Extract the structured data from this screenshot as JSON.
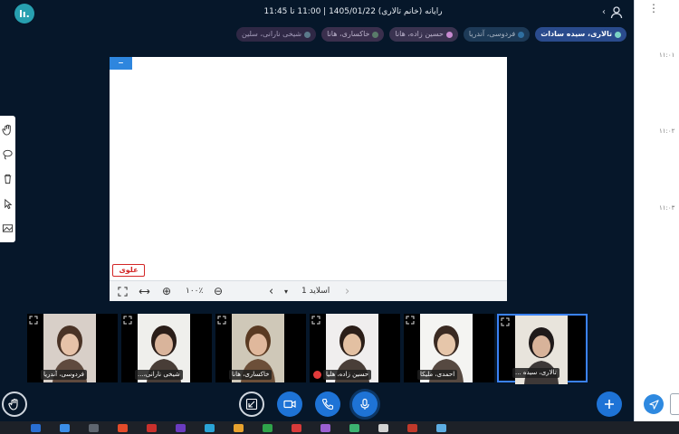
{
  "app": {
    "logo_text": "lı.",
    "meeting_title": "رایانه (خانم تالاری) 1405/01/22 | 11:00 تا 11:45",
    "chevron": "‹"
  },
  "participants": {
    "chips": [
      {
        "label": "تالاری، سیده سادات",
        "dot_color": "#7ad3c5",
        "style": "presenter"
      },
      {
        "label": "فردوسی، آندریا",
        "dot_color": "#2f6fa0",
        "style": "c2"
      },
      {
        "label": "حسین زاده، هانا",
        "dot_color": "#c78ad0",
        "style": "c3"
      },
      {
        "label": "خاکساری، هانا",
        "dot_color": "#5a7b6a",
        "style": "c4"
      },
      {
        "label": "شیخی نارانی، سلین",
        "dot_color": "#5b7a8b",
        "style": "c5"
      }
    ]
  },
  "chat": {
    "more_icon": "⋮",
    "times": [
      "۱۱:۰۱",
      "۱۱:۰۲",
      "۱۱:۰۳"
    ]
  },
  "whiteboard": {
    "minimize_label": "–",
    "stamp_text": "علوی",
    "toolbar": {
      "zoom_value": "۱۰۰٪",
      "zoom_in": "⊕",
      "zoom_out": "⊖",
      "slide_label": "اسلاید 1",
      "prev": "‹",
      "next": "›",
      "dropdown": "▾"
    }
  },
  "videos": [
    {
      "name": "فردوسی، آندریا",
      "bg": "#d8cfc8",
      "face": "#e6c2a8",
      "hair": "#4a3326",
      "mic_off": false
    },
    {
      "name": "شیخی نارانی،...",
      "bg": "#efefec",
      "face": "#d9b49b",
      "hair": "#2a1d18",
      "mic_off": false
    },
    {
      "name": "خاکساری، هانا",
      "bg": "#cfc8b8",
      "face": "#e0b89c",
      "hair": "#5a3a22",
      "mic_off": false
    },
    {
      "name": "حسین زاده، هلیا",
      "bg": "#f0eeee",
      "face": "#e3c0a2",
      "hair": "#2b1e18",
      "mic_off": true
    },
    {
      "name": "احمدی، ملیکا",
      "bg": "#f4f4f2",
      "face": "#e6c6aa",
      "hair": "#3a2a22",
      "mic_off": false
    },
    {
      "name": "تالاری، سیده ...",
      "bg": "#e8e4dc",
      "face": "#d8b39a",
      "hair": "#1f1a1a",
      "mic_off": false
    }
  ],
  "controls": {
    "raise_hand_icon": "hand-icon",
    "screen_share_icon": "screen-share-icon",
    "camera_icon": "camera-icon",
    "phone_icon": "phone-icon",
    "mic_icon": "mic-icon",
    "plus_icon": "plus-icon",
    "accent": "#1e73d6"
  },
  "taskbar": {
    "colors": [
      "#2a6fd1",
      "#3b8ee8",
      "#5f6670",
      "#e34b2a",
      "#c9302c",
      "#6a3bbf",
      "#2aa3d6",
      "#e8a22e",
      "#2fa34a",
      "#d63a3a",
      "#9a5fd0",
      "#3cb371",
      "#d2d2d2",
      "#c0392b",
      "#5dade2"
    ]
  }
}
